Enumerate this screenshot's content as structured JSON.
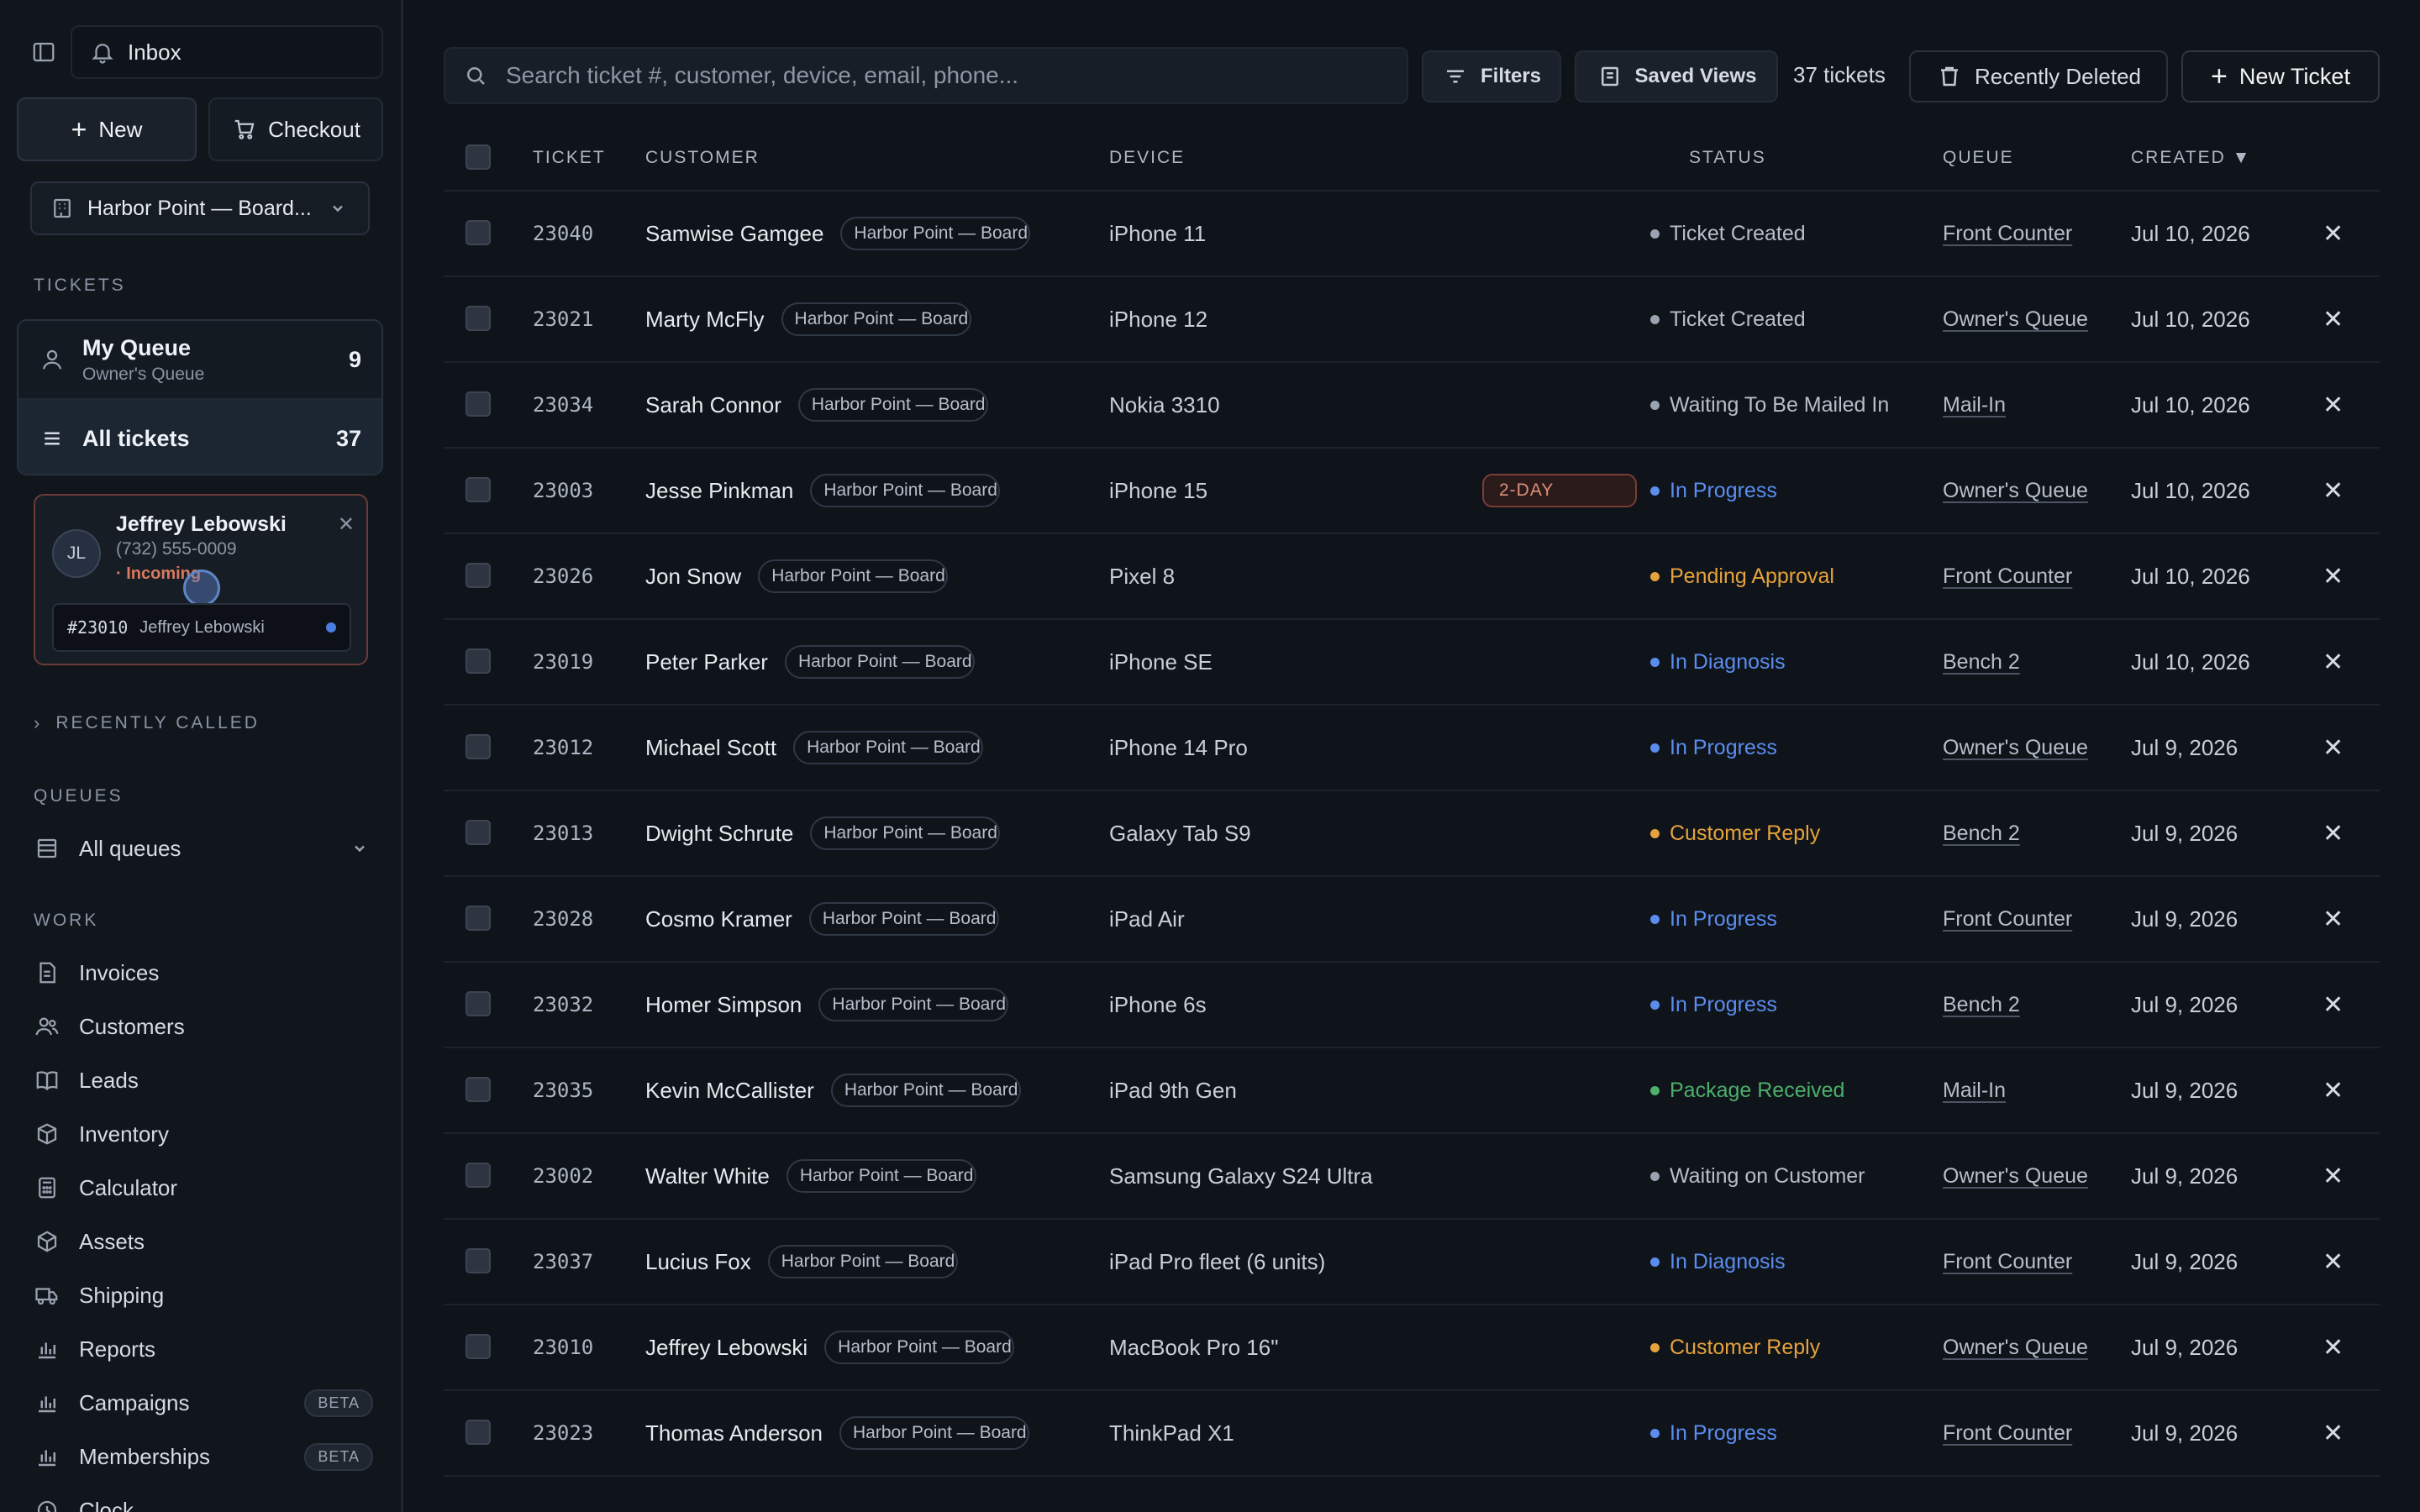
{
  "sidebar": {
    "inbox_label": "Inbox",
    "new_label": "New",
    "checkout_label": "Checkout",
    "location": "Harbor Point — Board...",
    "tickets_section": "TICKETS",
    "my_queue": {
      "title": "My Queue",
      "subtitle": "Owner's Queue",
      "count": "9"
    },
    "all_tickets": {
      "title": "All tickets",
      "count": "37"
    },
    "call": {
      "initials": "JL",
      "name": "Jeffrey Lebowski",
      "phone": "(732) 555-0009",
      "status": "· Incoming",
      "ticket_number": "#23010",
      "ticket_name": "Jeffrey Lebowski"
    },
    "recently_called": "RECENTLY CALLED",
    "queues_section": "QUEUES",
    "queues_select": "All queues",
    "work_section": "WORK",
    "nav": [
      {
        "label": "Invoices",
        "icon": "invoice-icon",
        "badge": ""
      },
      {
        "label": "Customers",
        "icon": "users-icon",
        "badge": ""
      },
      {
        "label": "Leads",
        "icon": "book-icon",
        "badge": ""
      },
      {
        "label": "Inventory",
        "icon": "box-icon",
        "badge": ""
      },
      {
        "label": "Calculator",
        "icon": "calculator-icon",
        "badge": ""
      },
      {
        "label": "Assets",
        "icon": "cube-icon",
        "badge": ""
      },
      {
        "label": "Shipping",
        "icon": "truck-icon",
        "badge": ""
      },
      {
        "label": "Reports",
        "icon": "bar-chart-icon",
        "badge": ""
      },
      {
        "label": "Campaigns",
        "icon": "bar-chart-icon",
        "badge": "BETA"
      },
      {
        "label": "Memberships",
        "icon": "bar-chart-icon",
        "badge": "BETA"
      },
      {
        "label": "Clock",
        "icon": "clock-icon",
        "badge": ""
      }
    ]
  },
  "toolbar": {
    "search_placeholder": "Search ticket #, customer, device, email, phone...",
    "filters_label": "Filters",
    "saved_views_label": "Saved Views",
    "ticket_count": "37 tickets",
    "recently_deleted_label": "Recently Deleted",
    "new_ticket_label": "New Ticket"
  },
  "table": {
    "headers": {
      "ticket": "TICKET",
      "customer": "CUSTOMER",
      "device": "DEVICE",
      "status": "STATUS",
      "queue": "QUEUE",
      "created": "CREATED ▼"
    },
    "status_colors": {
      "Ticket Created": "#9aa3b0",
      "Waiting To Be Mailed In": "#9aa3b0",
      "Waiting on Customer": "#9aa3b0",
      "In Progress": "#5b8def",
      "In Diagnosis": "#5b8def",
      "Pending Approval": "#e6a23c",
      "Customer Reply": "#e6a23c",
      "Package Received": "#4caf6a"
    },
    "rows": [
      {
        "id": "23040",
        "customer": "Samwise Gamgee",
        "location": "Harbor Point — Board",
        "device": "iPhone 11",
        "priority": "",
        "status": "Ticket Created",
        "queue": "Front Counter",
        "created": "Jul 10, 2026"
      },
      {
        "id": "23021",
        "customer": "Marty McFly",
        "location": "Harbor Point — Board",
        "device": "iPhone 12",
        "priority": "",
        "status": "Ticket Created",
        "queue": "Owner's Queue",
        "created": "Jul 10, 2026"
      },
      {
        "id": "23034",
        "customer": "Sarah Connor",
        "location": "Harbor Point — Board",
        "device": "Nokia 3310",
        "priority": "",
        "status": "Waiting To Be Mailed In",
        "queue": "Mail-In",
        "created": "Jul 10, 2026"
      },
      {
        "id": "23003",
        "customer": "Jesse Pinkman",
        "location": "Harbor Point — Board",
        "device": "iPhone 15",
        "priority": "2-DAY",
        "status": "In Progress",
        "queue": "Owner's Queue",
        "created": "Jul 10, 2026"
      },
      {
        "id": "23026",
        "customer": "Jon Snow",
        "location": "Harbor Point — Board",
        "device": "Pixel 8",
        "priority": "",
        "status": "Pending Approval",
        "queue": "Front Counter",
        "created": "Jul 10, 2026"
      },
      {
        "id": "23019",
        "customer": "Peter Parker",
        "location": "Harbor Point — Board",
        "device": "iPhone SE",
        "priority": "",
        "status": "In Diagnosis",
        "queue": "Bench 2",
        "created": "Jul 10, 2026"
      },
      {
        "id": "23012",
        "customer": "Michael Scott",
        "location": "Harbor Point — Board",
        "device": "iPhone 14 Pro",
        "priority": "",
        "status": "In Progress",
        "queue": "Owner's Queue",
        "created": "Jul 9, 2026"
      },
      {
        "id": "23013",
        "customer": "Dwight Schrute",
        "location": "Harbor Point — Board",
        "device": "Galaxy Tab S9",
        "priority": "",
        "status": "Customer Reply",
        "queue": "Bench 2",
        "created": "Jul 9, 2026"
      },
      {
        "id": "23028",
        "customer": "Cosmo Kramer",
        "location": "Harbor Point — Board",
        "device": "iPad Air",
        "priority": "",
        "status": "In Progress",
        "queue": "Front Counter",
        "created": "Jul 9, 2026"
      },
      {
        "id": "23032",
        "customer": "Homer Simpson",
        "location": "Harbor Point — Board",
        "device": "iPhone 6s",
        "priority": "",
        "status": "In Progress",
        "queue": "Bench 2",
        "created": "Jul 9, 2026"
      },
      {
        "id": "23035",
        "customer": "Kevin McCallister",
        "location": "Harbor Point — Board",
        "device": "iPad 9th Gen",
        "priority": "",
        "status": "Package Received",
        "queue": "Mail-In",
        "created": "Jul 9, 2026"
      },
      {
        "id": "23002",
        "customer": "Walter White",
        "location": "Harbor Point — Board",
        "device": "Samsung Galaxy S24 Ultra",
        "priority": "",
        "status": "Waiting on Customer",
        "queue": "Owner's Queue",
        "created": "Jul 9, 2026"
      },
      {
        "id": "23037",
        "customer": "Lucius Fox",
        "location": "Harbor Point — Board",
        "device": "iPad Pro fleet (6 units)",
        "priority": "",
        "status": "In Diagnosis",
        "queue": "Front Counter",
        "created": "Jul 9, 2026"
      },
      {
        "id": "23010",
        "customer": "Jeffrey Lebowski",
        "location": "Harbor Point — Board",
        "device": "MacBook Pro 16\"",
        "priority": "",
        "status": "Customer Reply",
        "queue": "Owner's Queue",
        "created": "Jul 9, 2026"
      },
      {
        "id": "23023",
        "customer": "Thomas Anderson",
        "location": "Harbor Point — Board",
        "device": "ThinkPad X1",
        "priority": "",
        "status": "In Progress",
        "queue": "Front Counter",
        "created": "Jul 9, 2026"
      }
    ]
  }
}
